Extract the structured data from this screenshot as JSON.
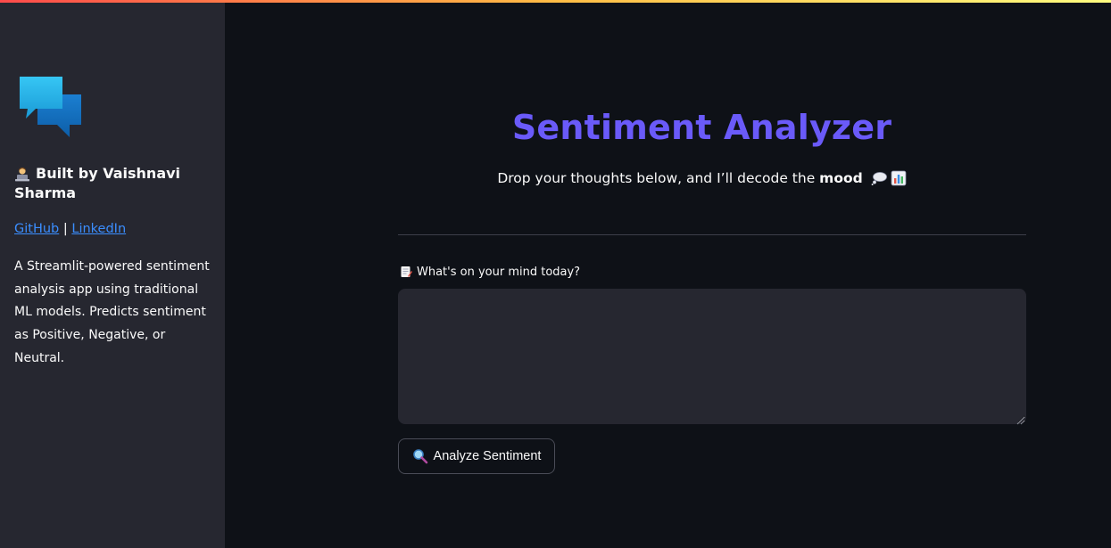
{
  "sidebar": {
    "logo_icon": "speech-bubbles-icon",
    "builder_icon": "person-at-laptop-icon",
    "builder_text": "Built by Vaishnavi Sharma",
    "links": {
      "github": "GitHub",
      "separator": "|",
      "linkedin": "LinkedIn"
    },
    "about": "A Streamlit-powered sentiment analysis app using traditional ML models. Predicts sentiment as Positive, Negative, or Neutral."
  },
  "main": {
    "title": "Sentiment Analyzer",
    "subtitle_prefix": "Drop your thoughts below, and I’ll decode the",
    "subtitle_bold": "mood",
    "subtitle_icons": [
      "thought-bubble-icon",
      "bar-chart-icon"
    ],
    "input_label": "What's on your mind today?",
    "input_label_icon": "memo-icon",
    "input_value": "",
    "input_placeholder": "",
    "analyze_button_label": "Analyze Sentiment",
    "analyze_button_icon": "magnifier-icon"
  },
  "colors": {
    "title": "#6a5af9",
    "link": "#3b8eff",
    "sidebar_bg": "#262730",
    "main_bg": "#0e1117",
    "input_bg": "#262730"
  }
}
